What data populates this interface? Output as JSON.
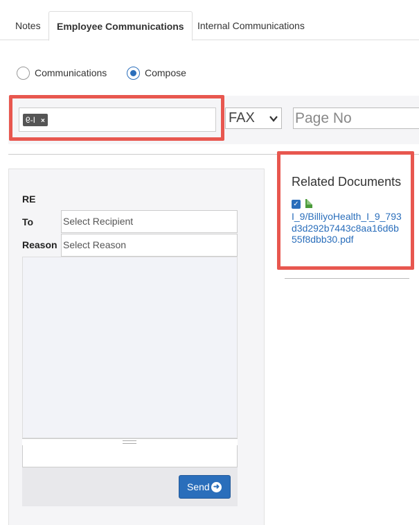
{
  "tabs": [
    {
      "label": "Notes"
    },
    {
      "label": "Employee Communications",
      "active": true
    },
    {
      "label": "Internal Communications"
    }
  ],
  "mode": {
    "options": [
      {
        "label": "Communications",
        "selected": false
      },
      {
        "label": "Compose",
        "selected": true
      }
    ]
  },
  "search": {
    "tag_label": "I-9",
    "tag_remove": "×",
    "fax_select": "FAX",
    "page_no_placeholder": "Page No"
  },
  "compose": {
    "re_label": "RE",
    "to_label": "To",
    "to_placeholder": "Select Recipient",
    "reason_label": "Reason",
    "reason_placeholder": "Select Reason",
    "send_label": "Send"
  },
  "related": {
    "title": "Related Documents",
    "documents": [
      {
        "name": "I_9/BilliyoHealth_I_9_793d3d292b7443c8aa16d6b55f8dbb30.pdf",
        "checked": true
      }
    ]
  },
  "colors": {
    "highlight": "#e8574f",
    "accent": "#2a6ebb"
  }
}
